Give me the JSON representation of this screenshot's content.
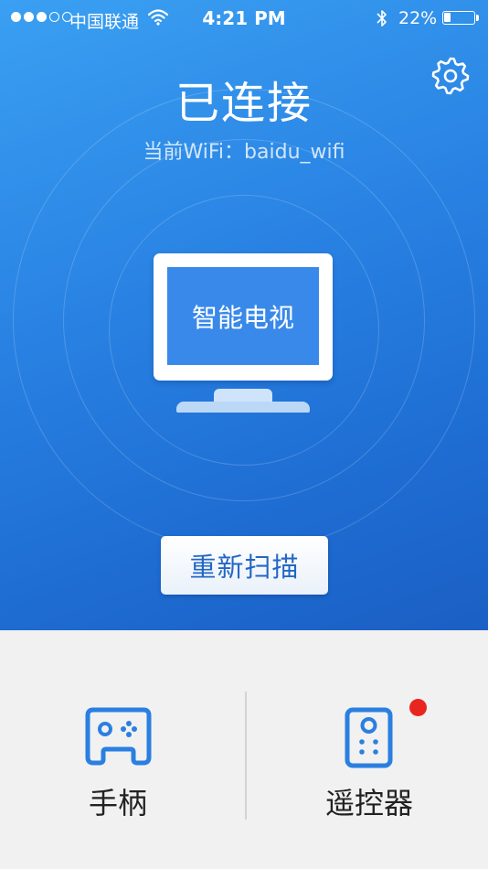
{
  "status_bar": {
    "signal_dots_total": 5,
    "signal_dots_filled": 3,
    "carrier": "中国联通",
    "time": "4:21 PM",
    "battery_percent": "22%",
    "battery_level": 0.22
  },
  "header": {
    "title": "已连接",
    "wifi_line": "当前WiFi：baidu_wifi",
    "settings_icon": "gear-icon"
  },
  "device": {
    "name": "智能电视",
    "icon": "tv-icon"
  },
  "actions": {
    "rescan_label": "重新扫描"
  },
  "features": [
    {
      "label": "手柄",
      "icon": "gamepad-icon",
      "badge": false
    },
    {
      "label": "遥控器",
      "icon": "remote-icon",
      "badge": true
    }
  ],
  "colors": {
    "accent": "#2a84e4",
    "primary_dark": "#1b5fc4",
    "icon_blue": "#2a7fe1",
    "badge_red": "#e8261f"
  }
}
